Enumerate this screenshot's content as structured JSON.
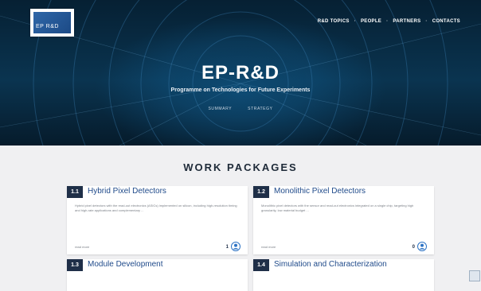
{
  "logo": {
    "text": "EP R&D"
  },
  "nav": {
    "items": [
      "R&D TOPICS",
      "PEOPLE",
      "PARTNERS",
      "CONTACTS"
    ],
    "separator": "·"
  },
  "hero": {
    "title": "EP-R&D",
    "subtitle": "Programme on Technologies for Future Experiments",
    "links": [
      "SUMMARY",
      "STRATEGY"
    ]
  },
  "section": {
    "title": "WORK PACKAGES"
  },
  "cards": [
    {
      "num": "1.1",
      "title": "Hybrid Pixel Detectors",
      "desc": "Hybrid pixel detectors with the read-out electronics (ASICs) implemented on silicon, including high-resolution timing and high-rate applications and complementary ...",
      "more": "read more",
      "count": "1"
    },
    {
      "num": "1.2",
      "title": "Monolithic Pixel Detectors",
      "desc": "Monolithic pixel detectors with the sensor and read-out electronics integrated on a single chip, targeting high granularity, low material budget ...",
      "more": "read more",
      "count": "0"
    },
    {
      "num": "1.3",
      "title": "Module Development",
      "desc": "",
      "more": "",
      "count": ""
    },
    {
      "num": "1.4",
      "title": "Simulation and Characterization",
      "desc": "",
      "more": "",
      "count": ""
    }
  ],
  "colors": {
    "hero_dark": "#062033",
    "card_num_bg": "#1f2f48",
    "card_title": "#1f4a8a",
    "page_bg": "#f0f0f2"
  }
}
